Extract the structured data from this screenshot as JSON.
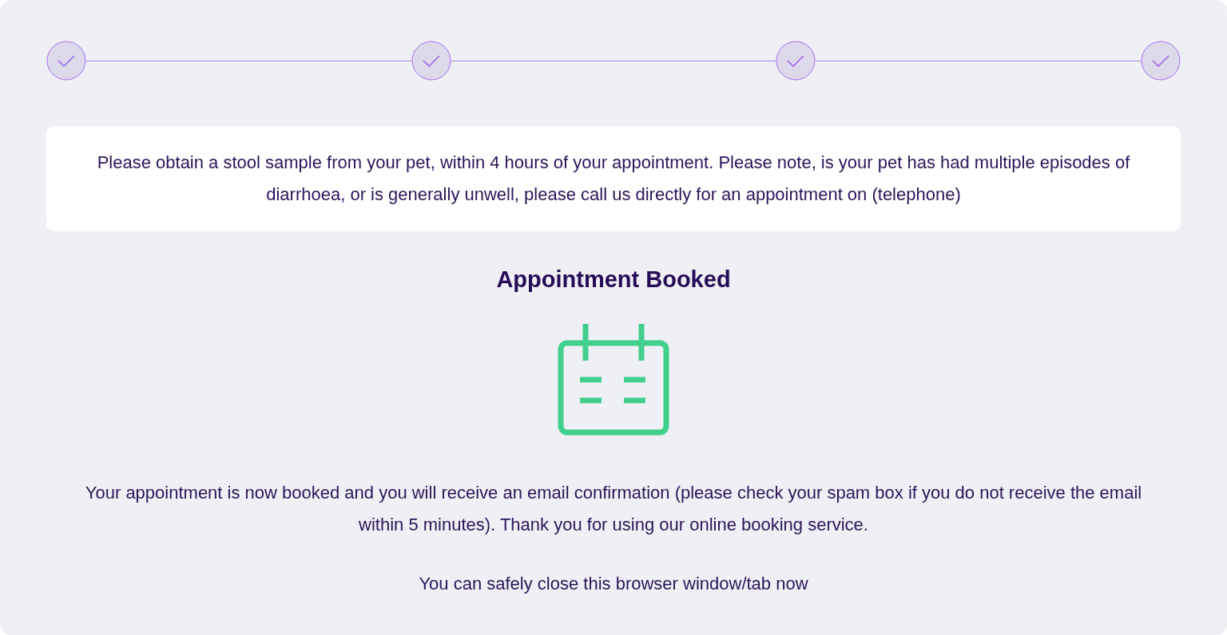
{
  "steps": [
    {
      "completed": true
    },
    {
      "completed": true
    },
    {
      "completed": true
    },
    {
      "completed": true
    }
  ],
  "notice": "Please obtain a stool sample from your pet, within 4 hours of your appointment. Please note, is your pet has had multiple episodes of diarrhoea, or is generally unwell, please call us directly for an appointment on (telephone)",
  "title": "Appointment Booked",
  "confirmation": "Your appointment is now booked and you will receive an email confirmation (please check your spam box if you do not receive the email within 5 minutes). Thank you for using our online booking service.",
  "closing_note": "You can safely close this browser window/tab now"
}
